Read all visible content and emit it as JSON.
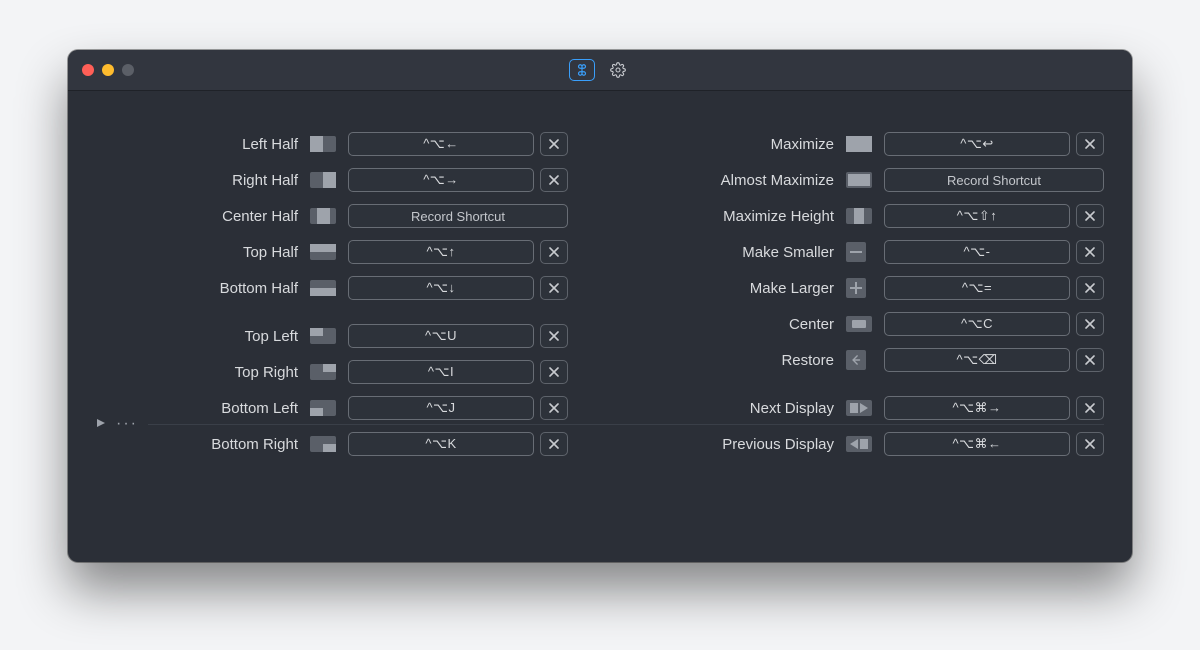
{
  "record_placeholder": "Record Shortcut",
  "left": {
    "groups": [
      [
        {
          "id": "left-half",
          "label": "Left Half",
          "icon": "lh",
          "shortcut": "^⌥←",
          "clearable": true
        },
        {
          "id": "right-half",
          "label": "Right Half",
          "icon": "rh",
          "shortcut": "^⌥→",
          "clearable": true
        },
        {
          "id": "center-half",
          "label": "Center Half",
          "icon": "ch",
          "shortcut": "",
          "clearable": false
        },
        {
          "id": "top-half",
          "label": "Top Half",
          "icon": "th",
          "shortcut": "^⌥↑",
          "clearable": true
        },
        {
          "id": "bottom-half",
          "label": "Bottom Half",
          "icon": "bh",
          "shortcut": "^⌥↓",
          "clearable": true
        }
      ],
      [
        {
          "id": "top-left",
          "label": "Top Left",
          "icon": "tl",
          "shortcut": "^⌥U",
          "clearable": true
        },
        {
          "id": "top-right",
          "label": "Top Right",
          "icon": "tr",
          "shortcut": "^⌥I",
          "clearable": true
        },
        {
          "id": "bottom-left",
          "label": "Bottom Left",
          "icon": "bl",
          "shortcut": "^⌥J",
          "clearable": true
        },
        {
          "id": "bottom-right",
          "label": "Bottom Right",
          "icon": "br",
          "shortcut": "^⌥K",
          "clearable": true
        }
      ]
    ]
  },
  "right": {
    "groups": [
      [
        {
          "id": "maximize",
          "label": "Maximize",
          "icon": "max",
          "shortcut": "^⌥↩",
          "clearable": true
        },
        {
          "id": "almost-maximize",
          "label": "Almost Maximize",
          "icon": "amax",
          "shortcut": "",
          "clearable": false
        },
        {
          "id": "maximize-height",
          "label": "Maximize Height",
          "icon": "mh",
          "shortcut": "^⌥⇧↑",
          "clearable": true
        },
        {
          "id": "make-smaller",
          "label": "Make Smaller",
          "icon": "minus",
          "square": true,
          "shortcut": "^⌥-",
          "clearable": true
        },
        {
          "id": "make-larger",
          "label": "Make Larger",
          "icon": "plus",
          "square": true,
          "shortcut": "^⌥=",
          "clearable": true
        },
        {
          "id": "center",
          "label": "Center",
          "icon": "center",
          "shortcut": "^⌥C",
          "clearable": true
        },
        {
          "id": "restore",
          "label": "Restore",
          "icon": "restore",
          "square": true,
          "shortcut": "^⌥⌫",
          "clearable": true
        }
      ],
      [
        {
          "id": "next-display",
          "label": "Next Display",
          "icon": "nd",
          "shortcut": "^⌥⌘→",
          "clearable": true
        },
        {
          "id": "previous-display",
          "label": "Previous Display",
          "icon": "pd",
          "shortcut": "^⌥⌘←",
          "clearable": true
        }
      ]
    ]
  }
}
